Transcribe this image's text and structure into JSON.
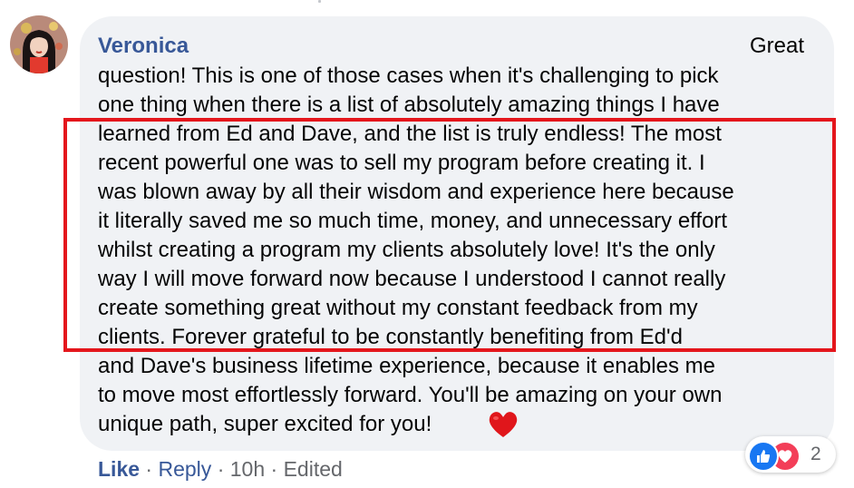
{
  "comment": {
    "author": "Veronica",
    "text_first_line": "Great",
    "text_lines": [
      "question! This is one of those cases when it's challenging to pick",
      "one thing when there is a list of absolutely amazing things I have",
      "learned from Ed and Dave, and the list is truly endless! The most",
      "recent powerful one was to sell my program before creating it. I",
      "was blown away by all their wisdom and experience here because",
      "it literally saved me so much time, money, and unnecessary effort",
      "whilst creating a program my clients absolutely love! It's the only",
      "way I will move forward now because I understood I cannot really",
      "create something great without my constant feedback from my",
      "clients. Forever grateful to be constantly benefiting from Ed'd",
      "and Dave's business lifetime experience, because it enables me",
      "to move most effortlessly forward. You'll be amazing on your own",
      "unique path, super excited for you!"
    ],
    "trailing_emoji": "heart-emoji"
  },
  "reactions": {
    "count": "2",
    "icons": [
      "like-reaction-icon",
      "love-reaction-icon"
    ]
  },
  "actions": {
    "like_label": "Like",
    "separator": "·",
    "reply_label": "Reply",
    "timestamp": "10h",
    "edited_label": "Edited"
  },
  "colors": {
    "bubble_bg": "#f0f2f5",
    "author": "#385898",
    "text": "#050505",
    "meta": "#65676b",
    "highlight_border": "#e4161c",
    "like_blue": "#1877f2",
    "love_red": "#f33e58"
  }
}
